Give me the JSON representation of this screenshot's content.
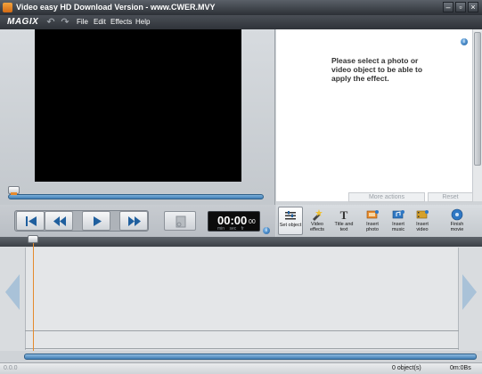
{
  "window": {
    "title": "Video easy HD Download Version - www.CWER.MVY",
    "controls": [
      "minimize",
      "maximize",
      "close"
    ]
  },
  "menubar": {
    "logo": "MAGIX",
    "undo_icon": "undo-icon",
    "redo_icon": "redo-icon",
    "items": [
      {
        "label": "File"
      },
      {
        "label": "Edit"
      },
      {
        "label": "Effects"
      },
      {
        "label": "Help"
      }
    ]
  },
  "effects_panel": {
    "message": "Please select a photo or video object to be able to apply the effect.",
    "more_actions_label": "More actions",
    "reset_label": "Reset"
  },
  "transport": {
    "buttons": [
      "skip-to-start-icon",
      "rewind-icon",
      "play-icon",
      "fast-forward-icon"
    ],
    "timecode": "00:00",
    "frames": "00",
    "units": "min sec fr"
  },
  "tools": [
    {
      "label": "Set object",
      "icon": "set-object-icon",
      "active": true
    },
    {
      "label": "Video effects",
      "icon": "video-effects-icon",
      "active": false
    },
    {
      "label": "Title and text",
      "icon": "title-text-icon",
      "active": false
    },
    {
      "label": "Insert photo",
      "icon": "insert-photo-icon",
      "active": false
    },
    {
      "label": "Insert music",
      "icon": "insert-music-icon",
      "active": false
    },
    {
      "label": "Insert video",
      "icon": "insert-video-icon",
      "active": false
    },
    {
      "label": "Finish movie",
      "icon": "finish-movie-icon",
      "active": false
    }
  ],
  "statusbar": {
    "left": "0.0.0",
    "objects": "0 object(s)",
    "duration": "0m:0Bs"
  },
  "colors": {
    "accent_blue": "#3f7eb5",
    "playhead_orange": "#e48a2c",
    "titlebar_dark": "#2c3036"
  }
}
